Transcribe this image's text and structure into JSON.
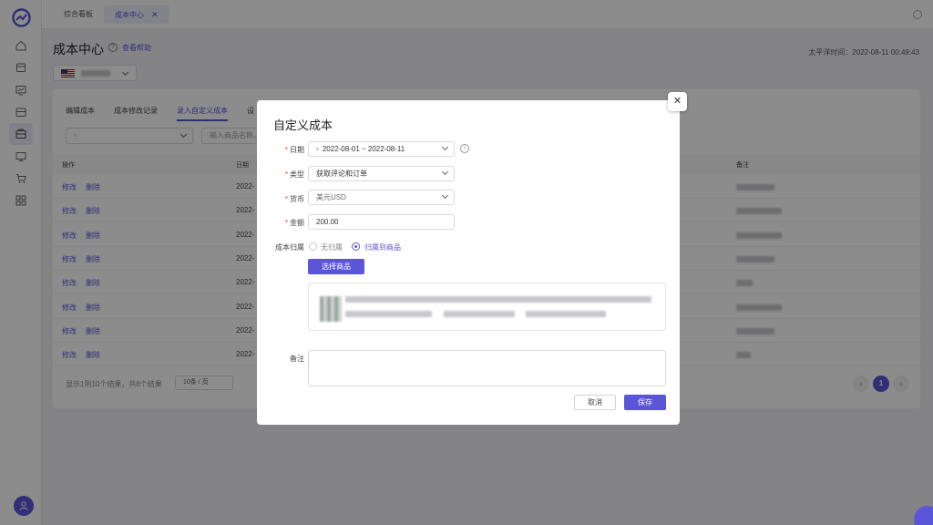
{
  "colors": {
    "accent": "#5b55d8",
    "required": "#e03b3b"
  },
  "tabs": [
    {
      "label": "综合看板"
    },
    {
      "label": "成本中心",
      "close": "✕"
    }
  ],
  "sidebar": {
    "icons": [
      "home-icon",
      "box-icon",
      "chart-icon",
      "store-icon",
      "cost-icon",
      "monitor-icon",
      "cart-icon",
      "apps-icon"
    ]
  },
  "header": {
    "title": "成本中心",
    "help_icon": "?",
    "help_link": "查看帮助",
    "time": "太平洋时间：2022-08-11 00:49:43"
  },
  "subtabs": [
    "编辑成本",
    "成本修改记录",
    "录入自定义成本",
    "设"
  ],
  "filters": {
    "search_placeholder": "输入商品名称、"
  },
  "table": {
    "headers": {
      "action": "操作",
      "date": "日期",
      "note": "备注"
    },
    "rows": [
      {
        "edit": "修改",
        "del": "删除",
        "date": "2022-"
      },
      {
        "edit": "修改",
        "del": "删除",
        "date": "2022-"
      },
      {
        "edit": "修改",
        "del": "删除",
        "date": "2022-"
      },
      {
        "edit": "修改",
        "del": "删除",
        "date": "2022-"
      },
      {
        "edit": "修改",
        "del": "删除",
        "date": "2022-"
      },
      {
        "edit": "修改",
        "del": "删除",
        "date": "2022-"
      },
      {
        "edit": "修改",
        "del": "删除",
        "date": "2022-"
      },
      {
        "edit": "修改",
        "del": "删除",
        "date": "2022-"
      }
    ]
  },
  "pagination": {
    "info": "显示1到10个结果，共8个结果",
    "page_size": "10条 / 页",
    "prev": "‹",
    "current": "1",
    "next": "›"
  },
  "modal": {
    "title": "自定义成本",
    "close": "✕",
    "required_mark": "*",
    "date_label": "日期",
    "date_value": "2022-08-01 ~ 2022-08-11",
    "info_icon": "i",
    "type_label": "类型",
    "type_value": "获取评论和订单",
    "currency_label": "货币",
    "currency_value": "美元USD",
    "amount_label": "金额",
    "amount_value": "200.00",
    "attribution_label": "成本归属",
    "option_none": "无归属",
    "option_product": "归属到商品",
    "select_product": "选择商品",
    "note_label": "备注",
    "cancel": "取消",
    "save": "保存"
  }
}
